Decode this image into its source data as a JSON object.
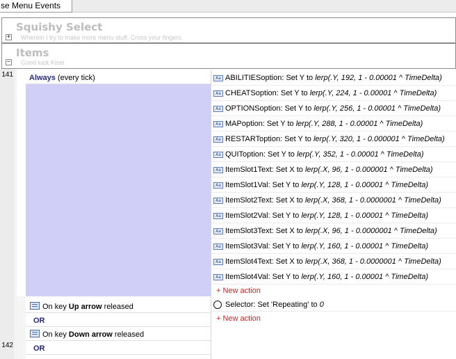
{
  "tab": {
    "label": "se Menu Events"
  },
  "groups": [
    {
      "title": "Squishy Select",
      "description": "Wherein I try to make more menu stuff. Cross your fingers.",
      "toggle": "+"
    },
    {
      "title": "Items",
      "description": "Good luck Kisei",
      "toggle": "−"
    }
  ],
  "events": [
    {
      "number": "141",
      "condition": {
        "keyword": "Always",
        "suffix": " (every tick)"
      },
      "actions": [
        {
          "object": "ABILITIESoption",
          "verb": ": Set Y to ",
          "expr": "lerp(.Y, 192, 1 - 0.00001 ^ TimeDelta)"
        },
        {
          "object": "CHEATSoption",
          "verb": ": Set Y to ",
          "expr": "lerp(.Y, 224, 1 - 0.00001 ^ TimeDelta)"
        },
        {
          "object": "OPTIONSoption",
          "verb": ": Set Y to ",
          "expr": "lerp(.Y, 256, 1 - 0.00001 ^ TimeDelta)"
        },
        {
          "object": "MAPoption",
          "verb": ": Set Y to ",
          "expr": "lerp(.Y, 288, 1 - 0.00001 ^ TimeDelta)"
        },
        {
          "object": "RESTARToption",
          "verb": ": Set Y to ",
          "expr": "lerp(.Y, 320, 1 - 0.000001 ^ TimeDelta)"
        },
        {
          "object": "QUIToption",
          "verb": ": Set Y to ",
          "expr": "lerp(.Y, 352, 1 - 0.00001 ^ TimeDelta)"
        },
        {
          "object": "ItemSlot1Text",
          "verb": ": Set X to ",
          "expr": "lerp(.X, 96, 1 - 0.000001 ^ TimeDelta)"
        },
        {
          "object": "ItemSlot1Val",
          "verb": ": Set Y to ",
          "expr": "lerp(.Y, 128, 1 - 0.00001 ^ TimeDelta)"
        },
        {
          "object": "ItemSlot2Text",
          "verb": ": Set X to ",
          "expr": "lerp(.X, 368, 1 - 0.0000001 ^ TimeDelta)"
        },
        {
          "object": "ItemSlot2Val",
          "verb": ": Set Y to ",
          "expr": "lerp(.Y, 128, 1 - 0.00001 ^ TimeDelta)"
        },
        {
          "object": "ItemSlot3Text",
          "verb": ": Set X to ",
          "expr": "lerp(.X, 96, 1 - 0.0000001 ^ TimeDelta)"
        },
        {
          "object": "ItemSlot3Val",
          "verb": ": Set Y to ",
          "expr": "lerp(.Y, 160, 1 - 0.00001 ^ TimeDelta)"
        },
        {
          "object": "ItemSlot4Text",
          "verb": ": Set X to ",
          "expr": "lerp(.X, 368, 1 - 0.0000001 ^ TimeDelta)"
        },
        {
          "object": "ItemSlot4Val",
          "verb": ": Set Y to ",
          "expr": "lerp(.Y, 160, 1 - 0.00001 ^ TimeDelta)"
        }
      ],
      "new_action": "+ New action",
      "sub_event": {
        "conditions": [
          {
            "prefix": "On key ",
            "key": "Up arrow",
            "suffix": " released"
          },
          {
            "or": "OR"
          },
          {
            "prefix": "On key ",
            "key": "Down arrow",
            "suffix": " released"
          },
          {
            "or": "OR"
          }
        ],
        "actions": [
          {
            "object": "Selector",
            "verb": ": Set 'Repeating' to ",
            "expr": "0"
          }
        ],
        "new_action": "+ New action"
      }
    },
    {
      "number": "142"
    }
  ],
  "colors": {
    "condition_bg": "#cfcff7",
    "new_action": "#cc1f1f",
    "keyword": "#2a2a7e"
  },
  "icons": {
    "action_icon": "sprite-object-icon",
    "keyboard_icon": "keyboard-icon",
    "system_icon": "system-circle-icon"
  }
}
